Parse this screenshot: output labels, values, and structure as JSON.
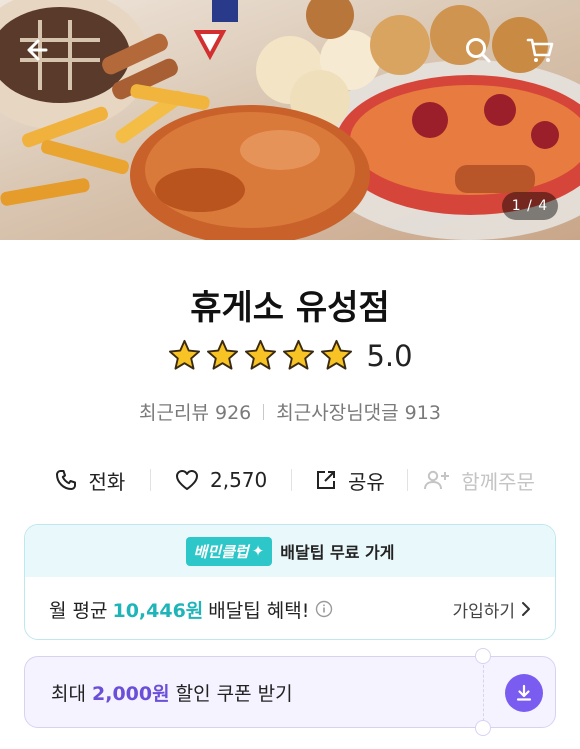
{
  "hero": {
    "page_counter": "1 / 4",
    "back_icon": "back-arrow-icon",
    "search_icon": "search-icon",
    "cart_icon": "cart-icon"
  },
  "store": {
    "name": "휴게소 유성점",
    "rating": "5.0",
    "star_count": 5,
    "recent_reviews_label": "최근리뷰 926",
    "recent_owner_replies_label": "최근사장님댓글 913"
  },
  "actions": {
    "call_label": "전화",
    "like_count": "2,570",
    "share_label": "공유",
    "group_order_label": "함께주문"
  },
  "club": {
    "badge": "배민클럽",
    "header_text": "배달팁 무료 가게",
    "benefit_prefix": "월 평균",
    "benefit_amount": "10,446원",
    "benefit_suffix": "배달팁 혜택!",
    "join_label": "가입하기"
  },
  "coupon": {
    "prefix": "최대",
    "amount": "2,000원",
    "suffix": "할인 쿠폰 받기"
  },
  "colors": {
    "accent_mint": "#2ec7c9",
    "accent_purple": "#7a5cf0",
    "star": "#f7c325"
  }
}
